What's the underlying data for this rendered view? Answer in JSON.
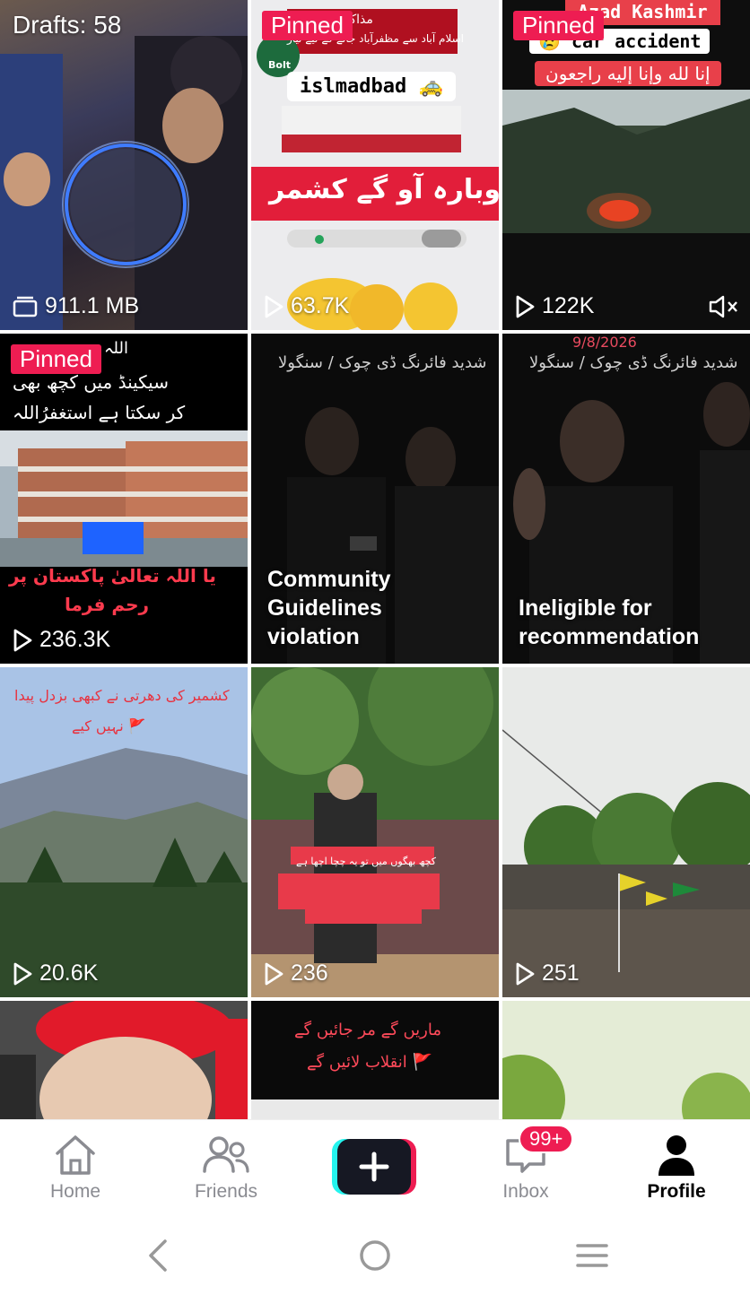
{
  "grid": {
    "drafts_label": "Drafts: 58",
    "drafts_size": "911.1 MB",
    "pinned_label": "Pinned",
    "tiles": [
      {
        "views": "63.7K",
        "overlay_lines": [
          "مذاکراتی کمیٹی",
          "اسلام آباد سے مظفرآباد جانے کے لیے تیار",
          "islmadbad 🚕",
          "دوبارہ آو گے کشمر"
        ],
        "brand": "Bolt"
      },
      {
        "views": "122K",
        "overlay_lines": [
          "Azad Kashmir",
          "😢 car accident",
          "إنا لله وإنا إليه راجعون"
        ]
      },
      {
        "views": "236.3K",
        "overlay_lines": [
          "اللہ",
          "سیکینڈ میں کچھ بھی",
          "کر سکتا ہے استغفرُاللہ",
          "یا اللہ تعالیٰ پاکستان پر",
          "رحم فرما"
        ]
      },
      {
        "status": "Community\nGuidelines\nviolation",
        "overlay_lines": [
          "شدید فائرنگ ڈی چوک / سنگولا"
        ]
      },
      {
        "status": "Ineligible for\nrecommendation",
        "overlay_lines": [
          "9/8/2026",
          "شدید فائرنگ ڈی چوک / سنگولا"
        ]
      },
      {
        "views": "20.6K",
        "overlay_lines": [
          "کشمیر کی دھرتی نے کبھی بزدل پیدا",
          "نہیں کیے 🚩"
        ]
      },
      {
        "views": "236",
        "overlay_lines": [
          "کچھ بھگوں میں تو یہ چچا اچھا ہے"
        ]
      },
      {
        "views": "251",
        "overlay_lines": []
      },
      {
        "overlay_lines": []
      },
      {
        "overlay_lines": [
          "ماریں گے مر جائیں گے",
          "انقلاب لائیں گے 🚩"
        ]
      },
      {
        "overlay_lines": []
      }
    ]
  },
  "nav": {
    "home": "Home",
    "friends": "Friends",
    "inbox": "Inbox",
    "inbox_badge": "99+",
    "profile": "Profile"
  },
  "colors": {
    "accent": "#ee1d52",
    "cyan": "#25f4ee",
    "inactive": "#8a8b91"
  }
}
